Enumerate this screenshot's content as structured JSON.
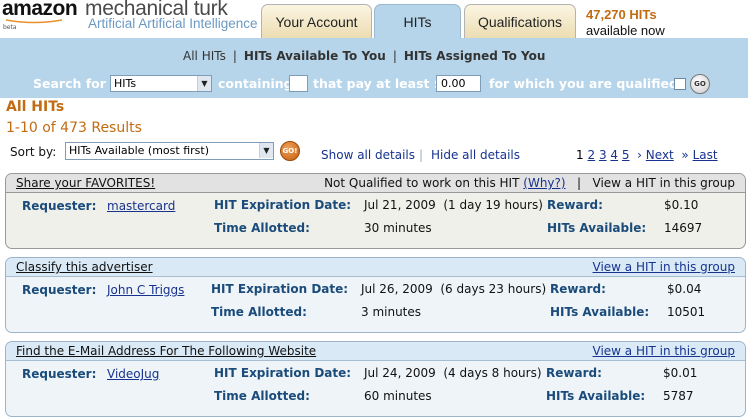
{
  "logo": {
    "amazon": "amazon",
    "mechanical_turk": "mechanical turk",
    "subtitle": "Artificial Artificial Intelligence",
    "beta": "beta"
  },
  "tabs": [
    {
      "label": "Your Account",
      "active": false
    },
    {
      "label": "HITs",
      "active": true
    },
    {
      "label": "Qualifications",
      "active": false
    }
  ],
  "stats": {
    "count": "47,270 HITs",
    "sub": "available now"
  },
  "subnav": {
    "all_hits": "All HITs",
    "available_to_you": "HITs Available To You",
    "assigned_to_you": "HITs Assigned To You"
  },
  "search": {
    "search_for": "Search for",
    "type_value": "HITs",
    "containing": "containing",
    "keyword_value": "",
    "pay_text": "that pay at least $",
    "min_reward": "0.00",
    "qualified_text": "for which you are qualified",
    "go": "GO"
  },
  "results": {
    "heading": "All HITs",
    "range": "1-10 of 473 Results",
    "sort_label": "Sort by:",
    "sort_value": "HITs Available (most first)",
    "sort_go": "GO!",
    "show_details": "Show all details",
    "hide_details": "Hide all details"
  },
  "pagination": {
    "pages": [
      "1",
      "2",
      "3",
      "4",
      "5"
    ],
    "current": "1",
    "next": "Next",
    "last": "Last",
    "next_icon": "chevron-right-icon",
    "last_icon": "double-chevron-right-icon"
  },
  "hits": [
    {
      "title": "Share your FAVORITES!",
      "right_prefix": "Not Qualified to work on this HIT",
      "why": "(Why?)",
      "right_suffix": "View a HIT in this group",
      "requester_label": "Requester:",
      "requester": "mastercard",
      "expiration_label": "HIT Expiration Date:",
      "expiration": "Jul 21, 2009",
      "expiration_rel": "(1 day 19 hours)",
      "reward_label": "Reward:",
      "reward": "$0.10",
      "time_label": "Time Allotted:",
      "time": "30 minutes",
      "available_label": "HITs Available:",
      "available": "14697"
    },
    {
      "title": "Classify this advertiser",
      "view": "View a HIT in this group",
      "requester_label": "Requester:",
      "requester": "John C Triggs",
      "expiration_label": "HIT Expiration Date:",
      "expiration": "Jul 26, 2009",
      "expiration_rel": "(6 days 23 hours)",
      "reward_label": "Reward:",
      "reward": "$0.04",
      "time_label": "Time Allotted:",
      "time": "3 minutes",
      "available_label": "HITs Available:",
      "available": "10501"
    },
    {
      "title": "Find the E-Mail Address For The Following Website",
      "view": "View a HIT in this group",
      "requester_label": "Requester:",
      "requester": "VideoJug",
      "expiration_label": "HIT Expiration Date:",
      "expiration": "Jul 24, 2009",
      "expiration_rel": "(4 days 8 hours)",
      "reward_label": "Reward:",
      "reward": "$0.01",
      "time_label": "Time Allotted:",
      "time": "60 minutes",
      "available_label": "HITs Available:",
      "available": "5787"
    }
  ],
  "colors": {
    "band": "#b6d5ea",
    "accent_orange": "#c16c12",
    "link": "#17338f",
    "label": "#1a4b7a"
  }
}
